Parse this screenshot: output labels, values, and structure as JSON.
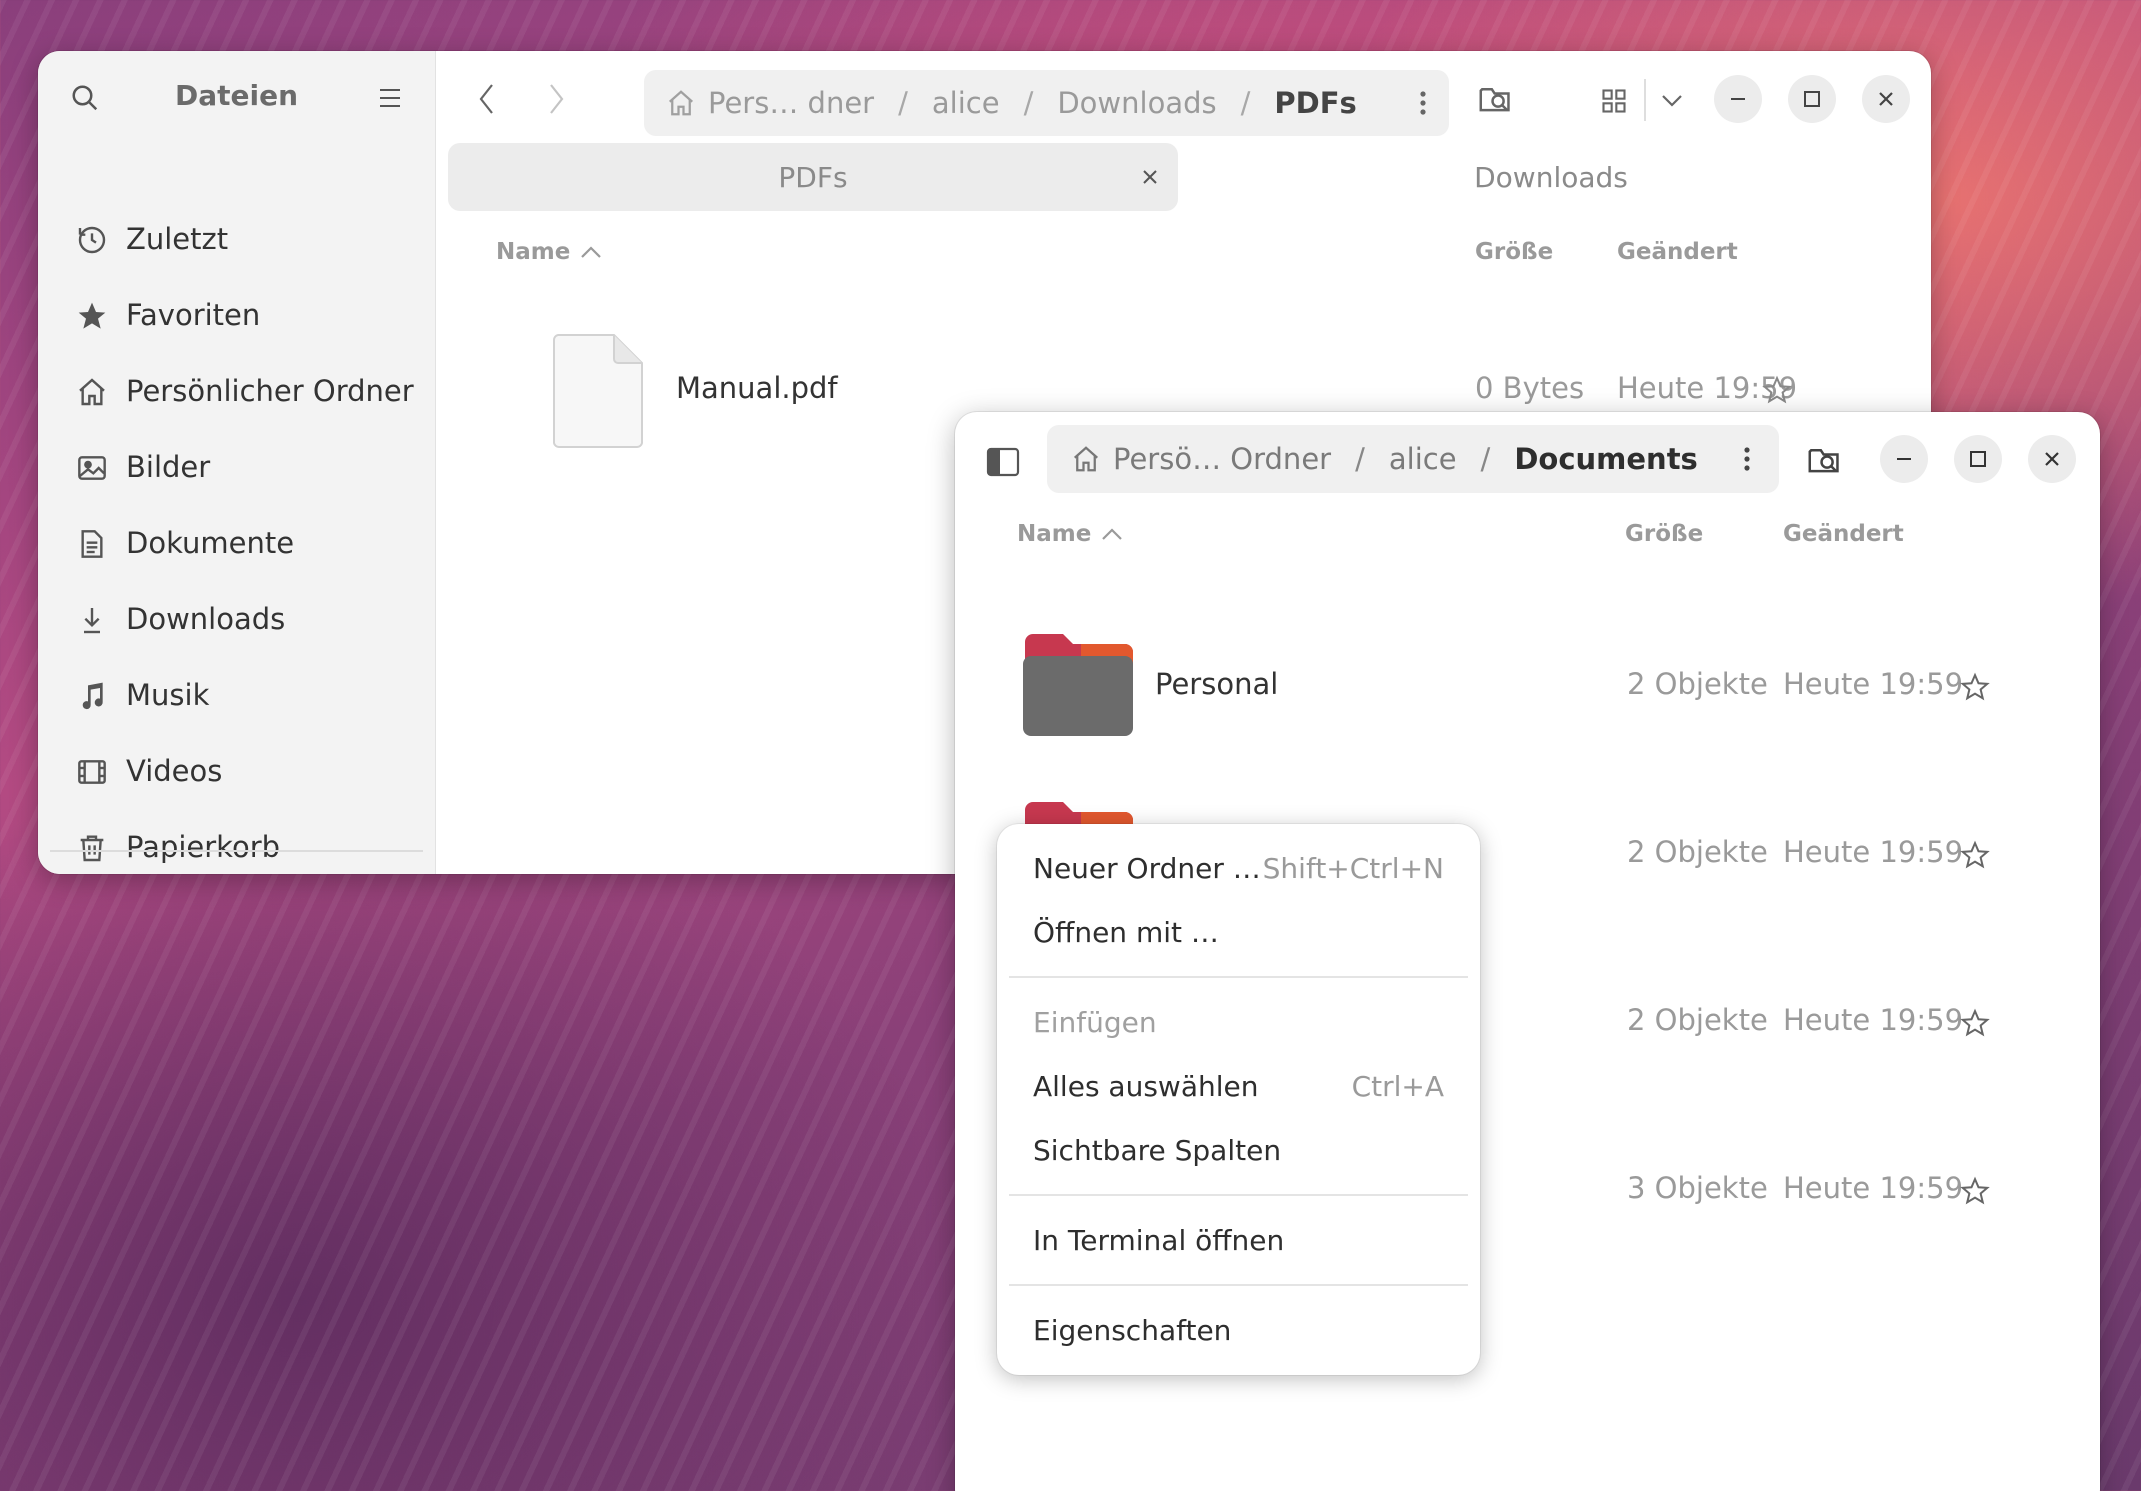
{
  "window_back": {
    "sidebar": {
      "title": "Dateien",
      "items": [
        {
          "label": "Zuletzt",
          "icon": "clock-icon"
        },
        {
          "label": "Favoriten",
          "icon": "star-filled-icon"
        },
        {
          "label": "Persönlicher Ordner",
          "icon": "home-icon"
        },
        {
          "label": "Bilder",
          "icon": "image-icon"
        },
        {
          "label": "Dokumente",
          "icon": "document-icon"
        },
        {
          "label": "Downloads",
          "icon": "download-icon"
        },
        {
          "label": "Musik",
          "icon": "music-icon"
        },
        {
          "label": "Videos",
          "icon": "video-icon"
        },
        {
          "label": "Papierkorb",
          "icon": "trash-icon"
        }
      ]
    },
    "path": [
      "Pers… dner",
      "alice",
      "Downloads",
      "PDFs"
    ],
    "tabs": [
      {
        "label": "PDFs",
        "active": true
      },
      {
        "label": "Downloads",
        "active": false
      }
    ],
    "columns": {
      "name": "Name",
      "size": "Größe",
      "modified": "Geändert"
    },
    "files": [
      {
        "name": "Manual.pdf",
        "size": "0 Bytes",
        "modified": "Heute 19:59"
      }
    ]
  },
  "window_front": {
    "path": [
      "Persö… Ordner",
      "alice",
      "Documents"
    ],
    "columns": {
      "name": "Name",
      "size": "Größe",
      "modified": "Geändert"
    },
    "folders": [
      {
        "name": "Personal",
        "size": "2 Objekte",
        "modified": "Heute 19:59"
      },
      {
        "name": "",
        "size": "2 Objekte",
        "modified": "Heute 19:59"
      },
      {
        "name": "",
        "size": "2 Objekte",
        "modified": "Heute 19:59"
      },
      {
        "name": "",
        "size": "3 Objekte",
        "modified": "Heute 19:59"
      }
    ]
  },
  "context_menu": {
    "items": [
      {
        "label": "Neuer Ordner …",
        "accel": "Shift+Ctrl+N"
      },
      {
        "label": "Öffnen mit …",
        "accel": ""
      },
      {
        "label": "Einfügen",
        "accel": "",
        "disabled": true
      },
      {
        "label": "Alles auswählen",
        "accel": "Ctrl+A"
      },
      {
        "label": "Sichtbare Spalten",
        "accel": ""
      },
      {
        "label": "In Terminal öffnen",
        "accel": ""
      },
      {
        "label": "Eigenschaften",
        "accel": ""
      }
    ]
  },
  "colors": {
    "folder_accent": "#c7384f",
    "folder_body": "#6b6b6b"
  }
}
